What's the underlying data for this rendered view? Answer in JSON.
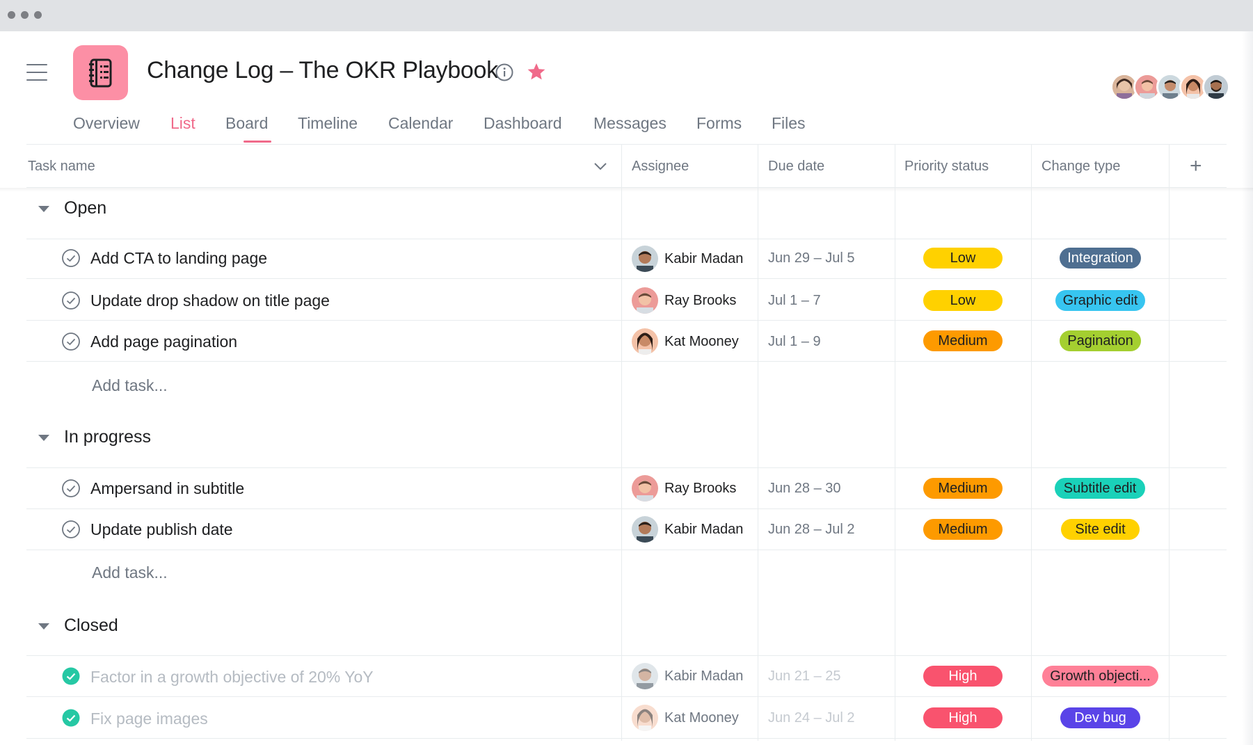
{
  "project": {
    "title": "Change Log – The OKR Playbook"
  },
  "icons": {
    "menu": "hamburger-icon",
    "app": "notebook-list-icon",
    "info": "info-icon",
    "favorite": "star-icon",
    "add_column": "plus-icon",
    "sort": "chevron-down-icon",
    "complete": "check-circle-icon"
  },
  "colors": {
    "accent": "#f06a8a",
    "app_icon": "#fc8fa5",
    "star": "#f06a8a"
  },
  "tabs": [
    {
      "label": "Overview",
      "active": false
    },
    {
      "label": "List",
      "active": true
    },
    {
      "label": "Board",
      "active": false
    },
    {
      "label": "Timeline",
      "active": false
    },
    {
      "label": "Calendar",
      "active": false
    },
    {
      "label": "Dashboard",
      "active": false
    },
    {
      "label": "Messages",
      "active": false
    },
    {
      "label": "Forms",
      "active": false
    },
    {
      "label": "Files",
      "active": false
    }
  ],
  "columns": {
    "task_name": "Task name",
    "assignee": "Assignee",
    "due_date": "Due date",
    "priority": "Priority status",
    "change_type": "Change type",
    "add": "+"
  },
  "sections": [
    {
      "title": "Open",
      "add_task": "Add task...",
      "tasks": [
        {
          "name": "Add CTA to landing page",
          "assignee": "Kabir Madan",
          "due": "Jun 29 – Jul 5",
          "priority": "Low",
          "priority_color": "#ffd100",
          "type": "Integration",
          "type_color": "#4f6f91",
          "type_text": "#ffffff",
          "completed": false
        },
        {
          "name": "Update drop shadow on title page",
          "assignee": "Ray Brooks",
          "due": "Jul 1 – 7",
          "priority": "Low",
          "priority_color": "#ffd100",
          "type": "Graphic edit",
          "type_color": "#37c5f0",
          "type_text": "#1e1f21",
          "completed": false
        },
        {
          "name": "Add page pagination",
          "assignee": "Kat Mooney",
          "due": "Jul 1 – 9",
          "priority": "Medium",
          "priority_color": "#fd9a00",
          "type": "Pagination",
          "type_color": "#a4cf30",
          "type_text": "#1e1f21",
          "completed": false
        }
      ]
    },
    {
      "title": "In progress",
      "add_task": "Add task...",
      "tasks": [
        {
          "name": "Ampersand in subtitle",
          "assignee": "Ray Brooks",
          "due": "Jun 28 – 30",
          "priority": "Medium",
          "priority_color": "#fd9a00",
          "type": "Subtitle edit",
          "type_color": "#1ad1b9",
          "type_text": "#1e1f21",
          "completed": false
        },
        {
          "name": "Update publish date",
          "assignee": "Kabir Madan",
          "due": "Jun 28 – Jul 2",
          "priority": "Medium",
          "priority_color": "#fd9a00",
          "type": "Site edit",
          "type_color": "#ffd100",
          "type_text": "#1e1f21",
          "completed": false
        }
      ]
    },
    {
      "title": "Closed",
      "tasks": [
        {
          "name": "Factor in a growth objective of 20% YoY",
          "assignee": "Kabir Madan",
          "due": "Jun 21 – 25",
          "priority": "High",
          "priority_color": "#f9536e",
          "type": "Growth objecti...",
          "type_color": "#ff8097",
          "type_text": "#1e1f21",
          "completed": true
        },
        {
          "name": "Fix page images",
          "assignee": "Kat Mooney",
          "due": "Jun 24 – Jul 2",
          "priority": "High",
          "priority_color": "#f9536e",
          "type": "Dev bug",
          "type_color": "#5a44e8",
          "type_text": "#ffffff",
          "completed": true
        }
      ]
    }
  ]
}
